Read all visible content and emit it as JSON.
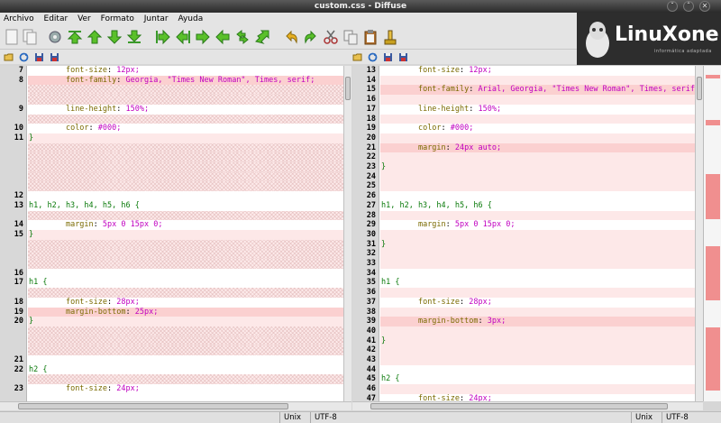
{
  "window": {
    "title": "custom.css - Diffuse",
    "controls": [
      "ˇ",
      "ˆ",
      "✕"
    ]
  },
  "menu": [
    "Archivo",
    "Editar",
    "Ver",
    "Formato",
    "Juntar",
    "Ayuda"
  ],
  "logo": {
    "text": "LinuXone",
    "subtitle": "informática adaptada"
  },
  "left_pane": [
    {
      "num": "7",
      "state": "plain",
      "indent": "        ",
      "prop": "font-size",
      "value": "12px;"
    },
    {
      "num": "8",
      "state": "diff",
      "indent": "        ",
      "prop": "font-family",
      "value": "Georgia, \"Times New Roman\", Times, serif;"
    },
    {
      "num": "",
      "state": "hatch"
    },
    {
      "num": "",
      "state": "hatch"
    },
    {
      "num": "9",
      "state": "plain",
      "indent": "        ",
      "prop": "line-height",
      "value": "150%;"
    },
    {
      "num": "",
      "state": "hatch"
    },
    {
      "num": "10",
      "state": "plain",
      "indent": "        ",
      "prop": "color",
      "value": "#000;"
    },
    {
      "num": "11",
      "state": "light",
      "brace": "}"
    },
    {
      "num": "",
      "state": "hatch"
    },
    {
      "num": "",
      "state": "hatch"
    },
    {
      "num": "",
      "state": "hatch"
    },
    {
      "num": "",
      "state": "hatch"
    },
    {
      "num": "",
      "state": "hatch"
    },
    {
      "num": "12",
      "state": "plain"
    },
    {
      "num": "13",
      "state": "plain",
      "selector": "h1, h2, h3, h4, h5, h6 ",
      "brace": "{"
    },
    {
      "num": "",
      "state": "hatch"
    },
    {
      "num": "14",
      "state": "plain",
      "indent": "        ",
      "prop": "margin",
      "value": "5px 0 15px 0;"
    },
    {
      "num": "15",
      "state": "light",
      "brace": "}"
    },
    {
      "num": "",
      "state": "hatch"
    },
    {
      "num": "",
      "state": "hatch"
    },
    {
      "num": "",
      "state": "hatch"
    },
    {
      "num": "16",
      "state": "plain"
    },
    {
      "num": "17",
      "state": "plain",
      "selector": "h1 ",
      "brace": "{"
    },
    {
      "num": "",
      "state": "hatch"
    },
    {
      "num": "18",
      "state": "plain",
      "indent": "        ",
      "prop": "font-size",
      "value": "28px;"
    },
    {
      "num": "19",
      "state": "diff",
      "indent": "        ",
      "prop": "margin-bottom",
      "value": "25px;"
    },
    {
      "num": "20",
      "state": "light",
      "brace": "}"
    },
    {
      "num": "",
      "state": "hatch"
    },
    {
      "num": "",
      "state": "hatch"
    },
    {
      "num": "",
      "state": "hatch"
    },
    {
      "num": "21",
      "state": "plain"
    },
    {
      "num": "22",
      "state": "plain",
      "selector": "h2 ",
      "brace": "{"
    },
    {
      "num": "",
      "state": "hatch"
    },
    {
      "num": "23",
      "state": "plain",
      "indent": "        ",
      "prop": "font-size",
      "value": "24px;"
    }
  ],
  "right_pane": [
    {
      "num": "13",
      "state": "plain",
      "indent": "        ",
      "prop": "font-size",
      "value": "12px;"
    },
    {
      "num": "14",
      "state": "light"
    },
    {
      "num": "15",
      "state": "diff",
      "indent": "        ",
      "prop": "font-family",
      "value": "Arial, Georgia, \"Times New Roman\", Times, serif;"
    },
    {
      "num": "16",
      "state": "light"
    },
    {
      "num": "17",
      "state": "plain",
      "indent": "        ",
      "prop": "line-height",
      "value": "150%;"
    },
    {
      "num": "18",
      "state": "light"
    },
    {
      "num": "19",
      "state": "plain",
      "indent": "        ",
      "prop": "color",
      "value": "#000;"
    },
    {
      "num": "20",
      "state": "light"
    },
    {
      "num": "21",
      "state": "diff",
      "indent": "        ",
      "prop": "margin",
      "value": "24px auto;"
    },
    {
      "num": "22",
      "state": "light"
    },
    {
      "num": "23",
      "state": "light",
      "brace": "}"
    },
    {
      "num": "24",
      "state": "light"
    },
    {
      "num": "25",
      "state": "light"
    },
    {
      "num": "26",
      "state": "plain"
    },
    {
      "num": "27",
      "state": "plain",
      "selector": "h1, h2, h3, h4, h5, h6 ",
      "brace": "{"
    },
    {
      "num": "28",
      "state": "light"
    },
    {
      "num": "29",
      "state": "plain",
      "indent": "        ",
      "prop": "margin",
      "value": "5px 0 15px 0;"
    },
    {
      "num": "30",
      "state": "light"
    },
    {
      "num": "31",
      "state": "light",
      "brace": "}"
    },
    {
      "num": "32",
      "state": "light"
    },
    {
      "num": "33",
      "state": "light"
    },
    {
      "num": "34",
      "state": "plain"
    },
    {
      "num": "35",
      "state": "plain",
      "selector": "h1 ",
      "brace": "{"
    },
    {
      "num": "36",
      "state": "light"
    },
    {
      "num": "37",
      "state": "plain",
      "indent": "        ",
      "prop": "font-size",
      "value": "28px;"
    },
    {
      "num": "38",
      "state": "light"
    },
    {
      "num": "39",
      "state": "diff",
      "indent": "        ",
      "prop": "margin-bottom",
      "value": "3px;"
    },
    {
      "num": "40",
      "state": "light"
    },
    {
      "num": "41",
      "state": "light",
      "brace": "}"
    },
    {
      "num": "42",
      "state": "light"
    },
    {
      "num": "43",
      "state": "light"
    },
    {
      "num": "44",
      "state": "plain"
    },
    {
      "num": "45",
      "state": "plain",
      "selector": "h2 ",
      "brace": "{"
    },
    {
      "num": "46",
      "state": "light"
    },
    {
      "num": "47",
      "state": "plain",
      "indent": "        ",
      "prop": "font-size",
      "value": "24px;"
    }
  ],
  "status_left": {
    "eol": "Unix",
    "encoding": "UTF-8"
  },
  "status_right": {
    "eol": "Unix",
    "encoding": "UTF-8"
  },
  "colors": {
    "diff": "#fbd0d0",
    "light": "#fde8e8",
    "hatch": "#fdeaea",
    "overview_mark": "#f08f8f"
  }
}
